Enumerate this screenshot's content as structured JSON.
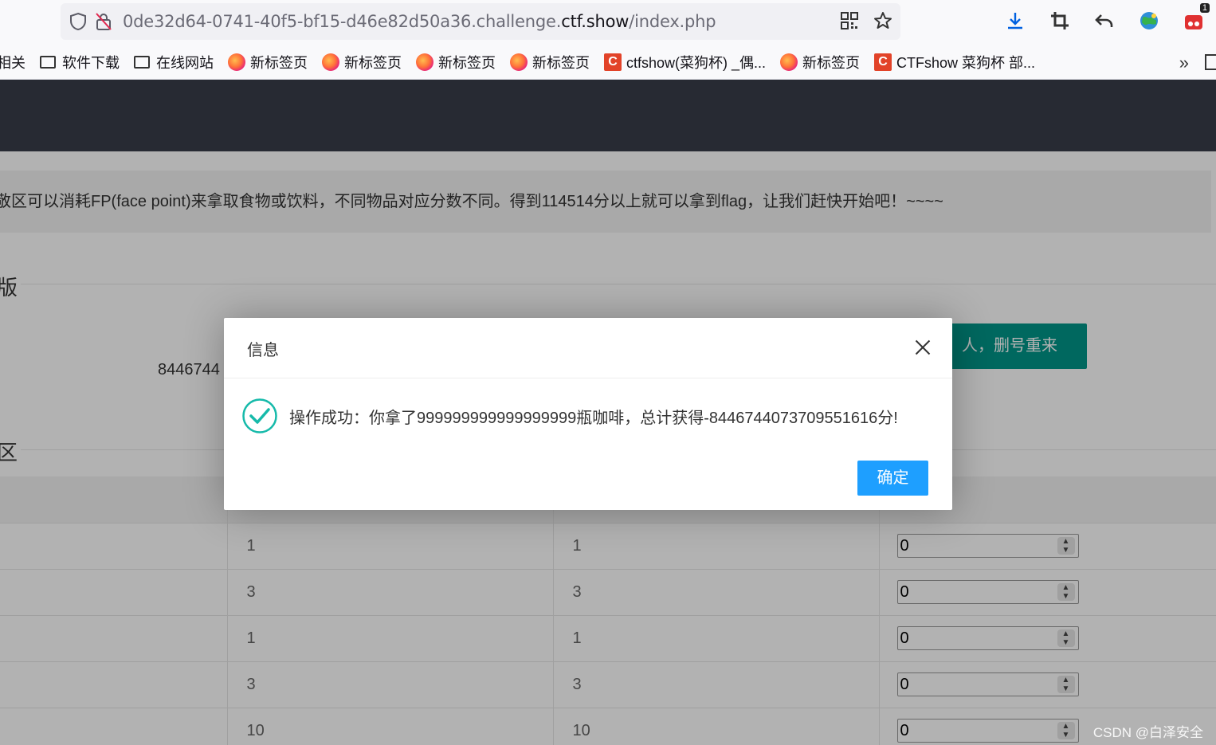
{
  "browser": {
    "url_prefix": "0de32d64-0741-40f5-bf15-d46e82d50a36.challenge.",
    "url_domain": "ctf.show",
    "url_path": "/index.php",
    "notification_count": "1"
  },
  "bookmarks": {
    "cut_item": "相关",
    "folder_1": "软件下载",
    "folder_2": "在线网站",
    "tab_1": "新标签页",
    "tab_2": "新标签页",
    "tab_3": "新标签页",
    "tab_4": "新标签页",
    "ctf_1": "ctfshow(菜狗杯) _偶...",
    "tab_5": "新标签页",
    "ctf_2": "CTFshow 菜狗杯 部..."
  },
  "page": {
    "notice": "敬区可以消耗FP(face point)来拿取食物或饮料，不同物品对应分数不同。得到114514分以上就可以拿到flag，让我们赶快开始吧！~~~~",
    "section_1": "版",
    "section_2": "区",
    "score": "8446744",
    "reset_label": "人，删号重来",
    "rows": [
      {
        "fp": "1",
        "score": "1",
        "qty": "0"
      },
      {
        "fp": "3",
        "score": "3",
        "qty": "0"
      },
      {
        "fp": "1",
        "score": "1",
        "qty": "0"
      },
      {
        "fp": "3",
        "score": "3",
        "qty": "0"
      },
      {
        "fp": "10",
        "score": "10",
        "qty": "0"
      }
    ]
  },
  "modal": {
    "title": "信息",
    "message": "操作成功：你拿了999999999999999999瓶咖啡，总计获得-8446744073709551616分!",
    "confirm_label": "确定"
  },
  "watermark": "CSDN @白泽安全",
  "colors": {
    "navbar": "#393d49",
    "reset_button": "#009688",
    "confirm_button": "#1e9fff",
    "success_icon": "#16baaa"
  }
}
